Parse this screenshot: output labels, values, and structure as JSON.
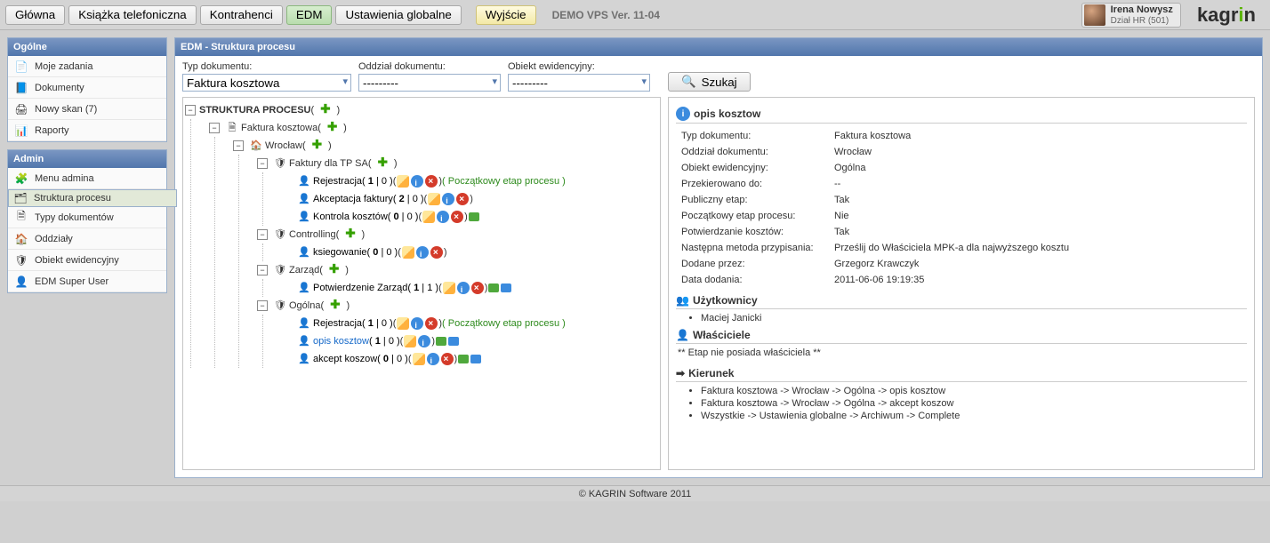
{
  "topnav": {
    "items": [
      {
        "label": "Główna",
        "state": ""
      },
      {
        "label": "Książka telefoniczna",
        "state": ""
      },
      {
        "label": "Kontrahenci",
        "state": ""
      },
      {
        "label": "EDM",
        "state": "active"
      },
      {
        "label": "Ustawienia globalne",
        "state": ""
      }
    ],
    "exit": "Wyjście",
    "version": "DEMO VPS Ver. 11-04"
  },
  "user": {
    "name": "Irena Nowysz",
    "dept": "Dział HR (501)"
  },
  "logo": {
    "a": "kagr",
    "b": "i",
    "c": "n"
  },
  "sidebar": {
    "groups": [
      {
        "title": "Ogólne",
        "items": [
          {
            "icon": "📄",
            "iconName": "task-icon",
            "name": "my-tasks",
            "label": "Moje zadania"
          },
          {
            "icon": "📘",
            "iconName": "documents-icon",
            "name": "documents",
            "label": "Dokumenty"
          },
          {
            "icon": "🖨",
            "iconName": "scan-icon",
            "name": "new-scan",
            "label": "Nowy skan (7)"
          },
          {
            "icon": "📊",
            "iconName": "reports-icon",
            "name": "reports",
            "label": "Raporty"
          }
        ]
      },
      {
        "title": "Admin",
        "items": [
          {
            "icon": "🧩",
            "iconName": "admin-menu-icon",
            "name": "admin-menu",
            "label": "Menu admina"
          },
          {
            "icon": "🗂",
            "iconName": "process-icon",
            "name": "process-structure",
            "label": "Struktura procesu",
            "sel": true
          },
          {
            "icon": "🗎",
            "iconName": "doc-types-icon",
            "name": "doc-types",
            "label": "Typy dokumentów"
          },
          {
            "icon": "🏠",
            "iconName": "branches-icon",
            "name": "branches",
            "label": "Oddziały"
          },
          {
            "icon": "🛡",
            "iconName": "evidence-icon",
            "name": "evidence-object",
            "label": "Obiekt ewidencyjny"
          },
          {
            "icon": "👤",
            "iconName": "superuser-icon",
            "name": "edm-superuser",
            "label": "EDM Super User"
          }
        ]
      }
    ]
  },
  "main": {
    "title": "EDM - Struktura procesu",
    "filters": {
      "doc_type": {
        "label": "Typ dokumentu:",
        "value": "Faktura kosztowa"
      },
      "branch": {
        "label": "Oddział dokumentu:",
        "value": "---------"
      },
      "evidence": {
        "label": "Obiekt ewidencyjny:",
        "value": "---------"
      },
      "search": "Szukaj"
    },
    "tree": {
      "root": {
        "label": "STRUKTURA PROCESU",
        "add": true
      },
      "doctype": {
        "label": "Faktura kosztowa",
        "add": true
      },
      "branch": {
        "label": "Wrocław",
        "add": true
      },
      "objects": [
        {
          "label": "Faktury dla TP SA",
          "add": true,
          "stages": [
            {
              "name": "Rejestracja",
              "c1": "1",
              "c2": "0",
              "icons": [
                "edit",
                "info",
                "del"
              ],
              "start": true,
              "start_label": "Początkowy etap procesu"
            },
            {
              "name": "Akceptacja faktury",
              "c1": "2",
              "c2": "0",
              "icons": [
                "edit",
                "info",
                "del"
              ]
            },
            {
              "name": "Kontrola kosztów",
              "c1": "0",
              "c2": "0",
              "icons": [
                "edit",
                "info",
                "del"
              ],
              "tail": [
                "green"
              ]
            }
          ]
        },
        {
          "label": "Controlling",
          "add": true,
          "stages": [
            {
              "name": "ksiegowanie",
              "c1": "0",
              "c2": "0",
              "icons": [
                "edit",
                "info",
                "del"
              ]
            }
          ]
        },
        {
          "label": "Zarząd",
          "add": true,
          "stages": [
            {
              "name": "Potwierdzenie Zarząd",
              "c1": "1",
              "c2": "1",
              "icons": [
                "edit",
                "info",
                "del"
              ],
              "tail": [
                "green",
                "blue"
              ]
            }
          ]
        },
        {
          "label": "Ogólna",
          "add": true,
          "stages": [
            {
              "name": "Rejestracja",
              "c1": "1",
              "c2": "0",
              "icons": [
                "edit",
                "info",
                "del"
              ],
              "start": true,
              "start_label": "Początkowy etap procesu"
            },
            {
              "name": "opis kosztow",
              "c1": "1",
              "c2": "0",
              "icons": [
                "edit",
                "info"
              ],
              "cur": true,
              "tail": [
                "green",
                "blue"
              ]
            },
            {
              "name": "akcept koszow",
              "c1": "0",
              "c2": "0",
              "icons": [
                "edit",
                "info",
                "del"
              ],
              "tail": [
                "green",
                "blue"
              ]
            }
          ]
        }
      ]
    },
    "details": {
      "title": "opis kosztow",
      "kv": [
        {
          "k": "Typ dokumentu:",
          "v": "Faktura kosztowa"
        },
        {
          "k": "Oddział dokumentu:",
          "v": "Wrocław"
        },
        {
          "k": "Obiekt ewidencyjny:",
          "v": "Ogólna"
        },
        {
          "k": "Przekierowano do:",
          "v": "--"
        },
        {
          "k": "Publiczny etap:",
          "v": "Tak"
        },
        {
          "k": "Początkowy etap procesu:",
          "v": "Nie"
        },
        {
          "k": "Potwierdzanie kosztów:",
          "v": "Tak"
        },
        {
          "k": "Następna metoda przypisania:",
          "v": "Prześlij do Właściciela MPK-a dla najwyższego kosztu"
        },
        {
          "k": "Dodane przez:",
          "v": "Grzegorz Krawczyk"
        },
        {
          "k": "Data dodania:",
          "v": "2011-06-06 19:19:35"
        }
      ],
      "users_hd": "Użytkownicy",
      "users": [
        "Maciej Janicki"
      ],
      "owners_hd": "Właściciele",
      "owners_empty": "** Etap nie posiada właściciela **",
      "dir_hd": "Kierunek",
      "directions": [
        "Faktura kosztowa -> Wrocław -> Ogólna -> opis kosztow",
        "Faktura kosztowa -> Wrocław -> Ogólna -> akcept koszow",
        "Wszystkie -> Ustawienia globalne -> Archiwum -> Complete"
      ]
    }
  },
  "footer": "© KAGRIN Software 2011"
}
